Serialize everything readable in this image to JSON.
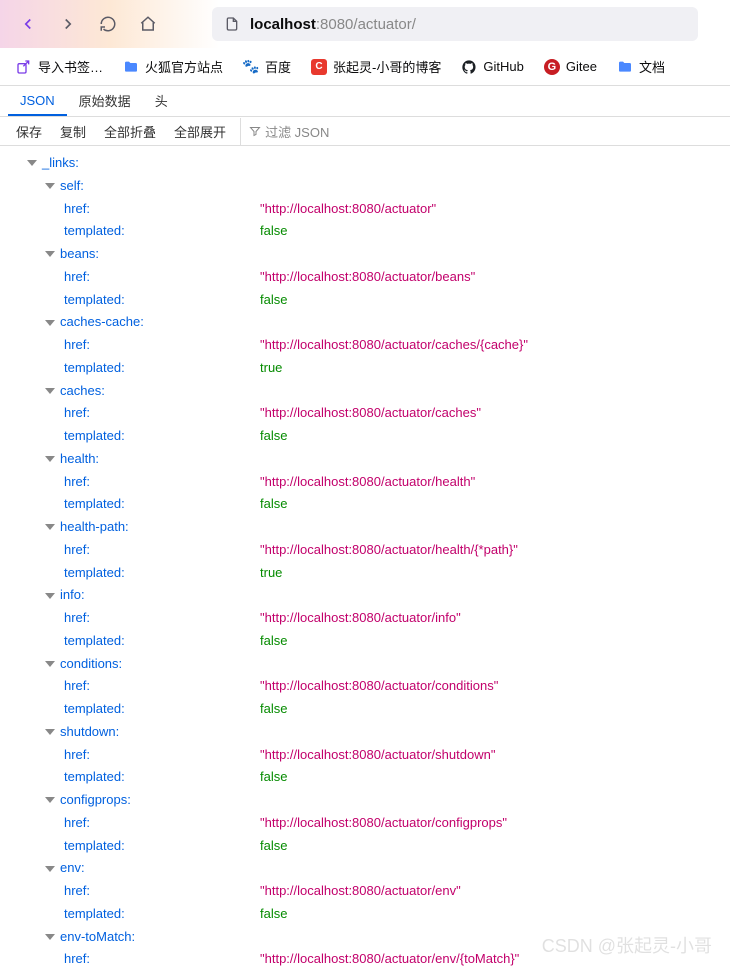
{
  "nav": {
    "url_host": "localhost",
    "url_port": ":8080",
    "url_path": "/actuator/"
  },
  "bookmarks": {
    "import": "导入书签…",
    "firefox": "火狐官方站点",
    "baidu": "百度",
    "blog": "张起灵-小哥的博客",
    "github": "GitHub",
    "gitee": "Gitee",
    "docs": "文档"
  },
  "tabs": {
    "json": "JSON",
    "raw": "原始数据",
    "headers": "头"
  },
  "actions": {
    "save": "保存",
    "copy": "复制",
    "collapseAll": "全部折叠",
    "expandAll": "全部展开",
    "filter": "过滤 JSON"
  },
  "json": {
    "rootKey": "_links:",
    "entries": [
      {
        "key": "self:",
        "href": "\"http://localhost:8080/actuator\"",
        "templated": "false"
      },
      {
        "key": "beans:",
        "href": "\"http://localhost:8080/actuator/beans\"",
        "templated": "false"
      },
      {
        "key": "caches-cache:",
        "href": "\"http://localhost:8080/actuator/caches/{cache}\"",
        "templated": "true"
      },
      {
        "key": "caches:",
        "href": "\"http://localhost:8080/actuator/caches\"",
        "templated": "false"
      },
      {
        "key": "health:",
        "href": "\"http://localhost:8080/actuator/health\"",
        "templated": "false"
      },
      {
        "key": "health-path:",
        "href": "\"http://localhost:8080/actuator/health/{*path}\"",
        "templated": "true"
      },
      {
        "key": "info:",
        "href": "\"http://localhost:8080/actuator/info\"",
        "templated": "false"
      },
      {
        "key": "conditions:",
        "href": "\"http://localhost:8080/actuator/conditions\"",
        "templated": "false"
      },
      {
        "key": "shutdown:",
        "href": "\"http://localhost:8080/actuator/shutdown\"",
        "templated": "false"
      },
      {
        "key": "configprops:",
        "href": "\"http://localhost:8080/actuator/configprops\"",
        "templated": "false"
      },
      {
        "key": "env:",
        "href": "\"http://localhost:8080/actuator/env\"",
        "templated": "false"
      },
      {
        "key": "env-toMatch:",
        "href": "\"http://localhost:8080/actuator/env/{toMatch}\"",
        "templated_partial": true
      }
    ],
    "hrefLabel": "href:",
    "templatedLabel": "templated:"
  },
  "watermark": "CSDN @张起灵-小哥"
}
